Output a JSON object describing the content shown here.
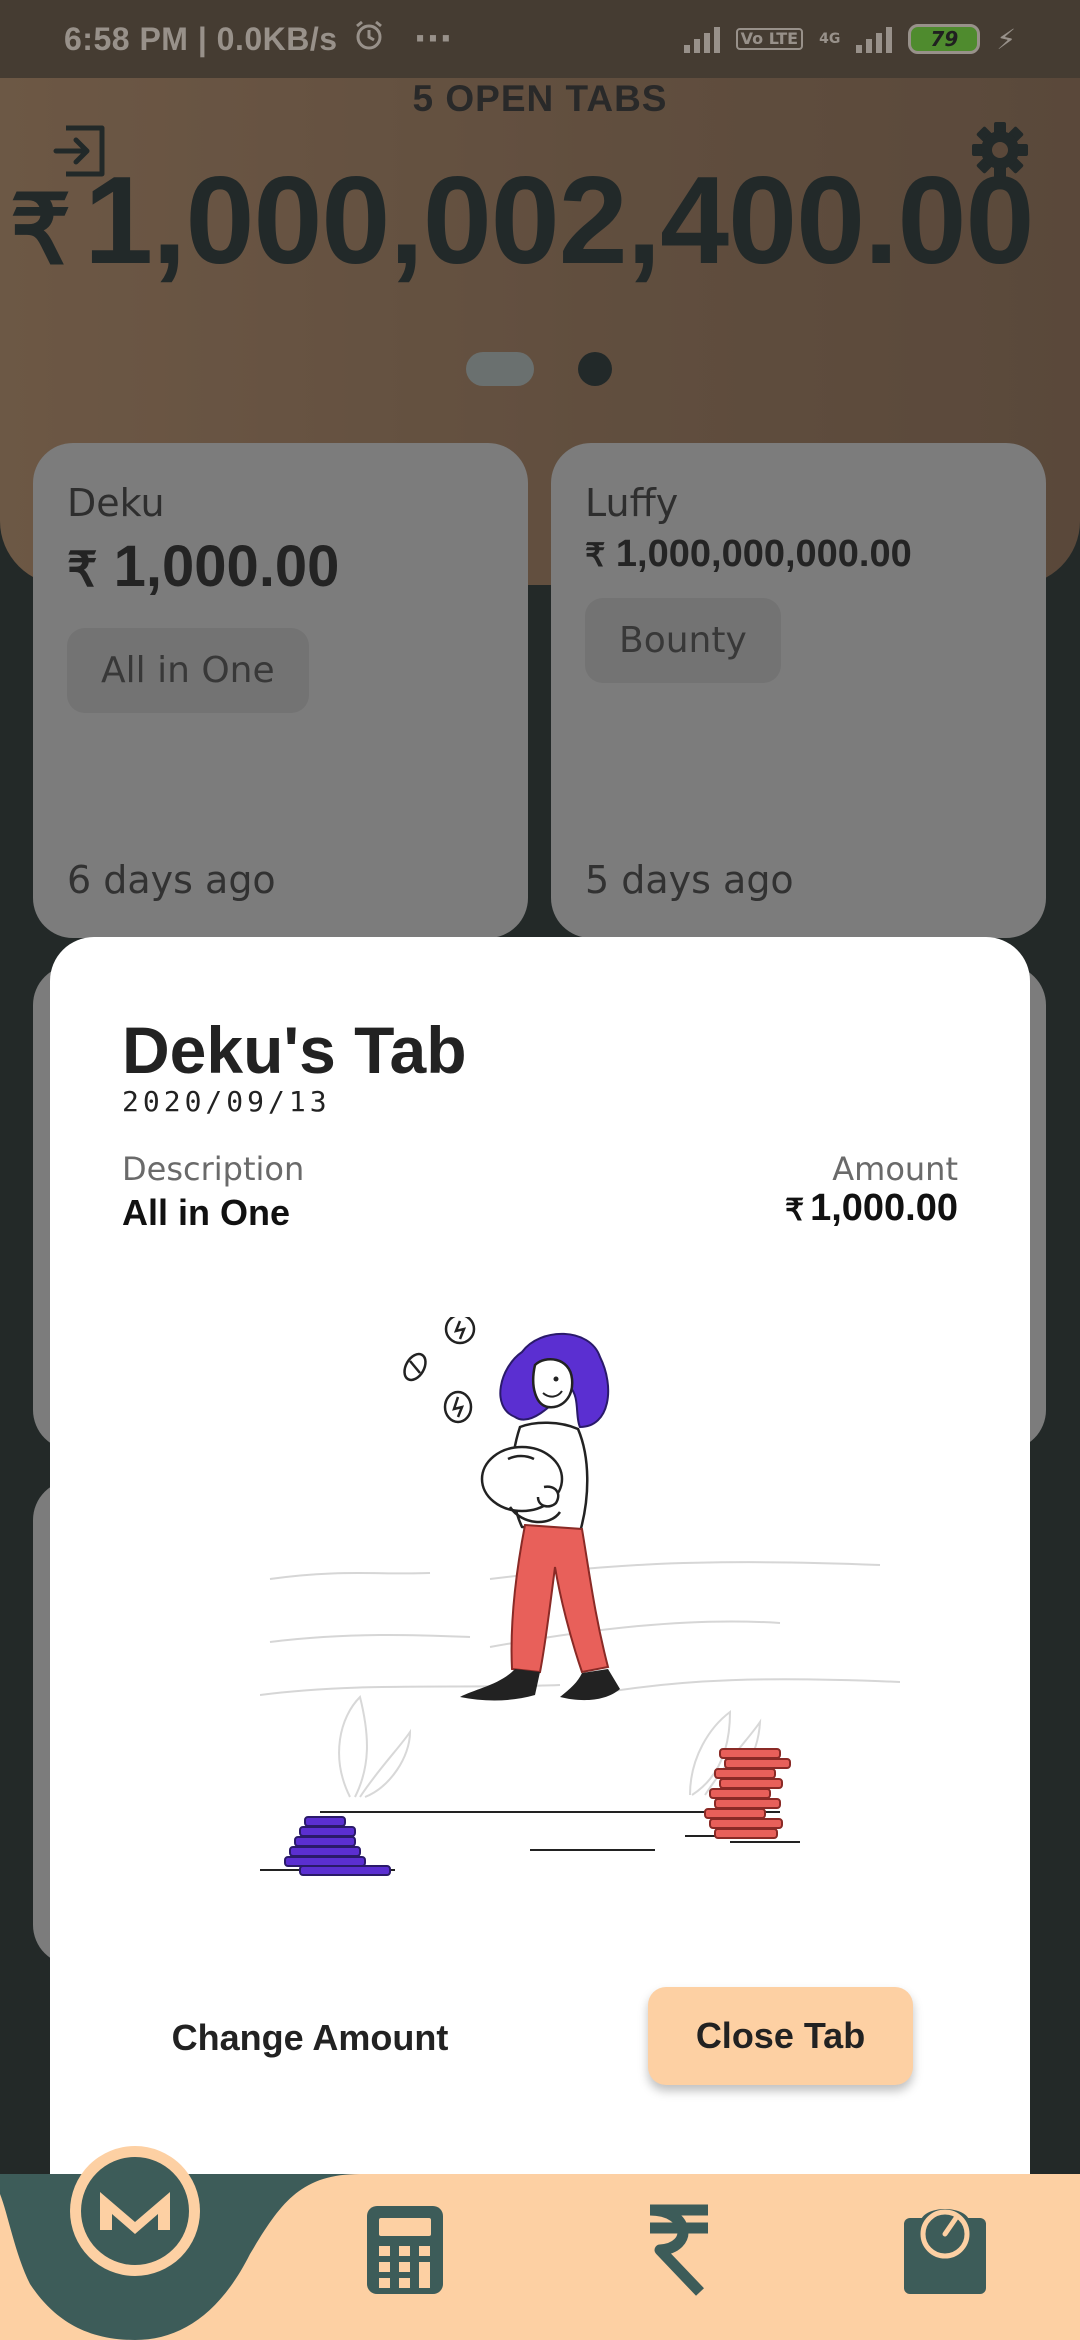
{
  "status_bar": {
    "time": "6:58 PM | 0.0KB/s",
    "more": "···",
    "volte": "Vo LTE",
    "network": "4G",
    "battery": "79"
  },
  "header": {
    "open_tabs_label": "5 OPEN TABS",
    "currency_symbol": "₹",
    "total_amount": "1,000,002,400.00",
    "page_index": 1,
    "page_count": 2
  },
  "cards": [
    {
      "name": "Deku",
      "currency_symbol": "₹",
      "amount": "1,000.00",
      "tag": "All in One",
      "time": "6 days ago"
    },
    {
      "name": "Luffy",
      "currency_symbol": "₹",
      "amount": "1,000,000,000.00",
      "tag": "Bounty",
      "time": "5 days ago"
    }
  ],
  "sheet": {
    "title": "Deku's Tab",
    "date": "2020/09/13",
    "description_label": "Description",
    "description_value": "All in One",
    "amount_label": "Amount",
    "currency_symbol": "₹",
    "amount_value": "1,000.00",
    "change_amount_label": "Change Amount",
    "close_tab_label": "Close Tab"
  },
  "bottom_nav": {
    "items": [
      "monero-logo-icon",
      "calculator-icon",
      "rupee-icon",
      "gauge-icon"
    ]
  },
  "colors": {
    "header_brown": "#8a6a4f",
    "dark_teal": "#1e2a2a",
    "peach": "#fdd0a3",
    "nav_teal": "#3d5c59",
    "coin_purple": "#5b2fd1",
    "coin_red": "#e8605a"
  }
}
